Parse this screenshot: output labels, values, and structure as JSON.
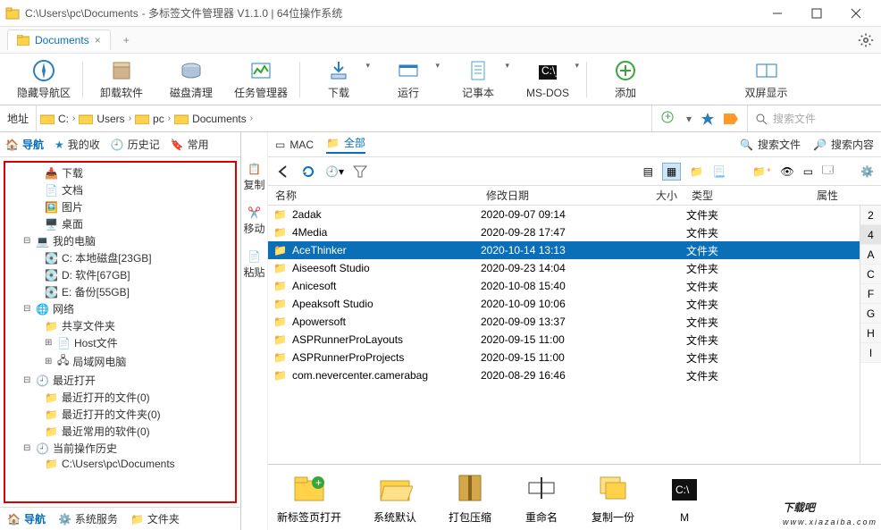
{
  "title": {
    "path": "C:\\Users\\pc\\Documents",
    "app": " - 多标签文件管理器 V1.1.0  |  64位操作系统"
  },
  "tab": {
    "name": "Documents"
  },
  "ribbon": [
    {
      "key": "hide-nav",
      "label": "隐藏导航区"
    },
    {
      "key": "uninstall",
      "label": "卸载软件"
    },
    {
      "key": "disk-clean",
      "label": "磁盘清理"
    },
    {
      "key": "task-manager",
      "label": "任务管理器"
    },
    {
      "key": "download",
      "label": "下载"
    },
    {
      "key": "run",
      "label": "运行"
    },
    {
      "key": "notepad",
      "label": "记事本"
    },
    {
      "key": "msdos",
      "label": "MS-DOS"
    },
    {
      "key": "add",
      "label": "添加"
    },
    {
      "key": "dual-screen",
      "label": "双屏显示"
    }
  ],
  "addr": {
    "label": "地址",
    "c": "C:",
    "users": "Users",
    "pc": "pc",
    "docs": "Documents",
    "search_ph": "搜索文件"
  },
  "left_tabs": {
    "nav": "导航",
    "myfav": "我的收",
    "history": "历史记",
    "common": "常用"
  },
  "tree": {
    "downloads": "下载",
    "docs": "文档",
    "pics": "图片",
    "desktop": "桌面",
    "mypc": "我的电脑",
    "cdrive": "C: 本地磁盘[23GB]",
    "ddrive": "D: 软件[67GB]",
    "edrive": "E: 备份[55GB]",
    "network": "网络",
    "share": "共享文件夹",
    "hosts": "Host文件",
    "lan": "局域网电脑",
    "recent": "最近打开",
    "recent_files": "最近打开的文件(0)",
    "recent_folders": "最近打开的文件夹(0)",
    "recent_apps": "最近常用的软件(0)",
    "ophist": "当前操作历史",
    "ophist_path": "C:\\Users\\pc\\Documents"
  },
  "bottom_tabs": {
    "nav": "导航",
    "services": "系统服务",
    "folder": "文件夹"
  },
  "side_actions": {
    "copy": "复制",
    "move": "移动",
    "paste": "粘贴"
  },
  "right_tabs": {
    "mac": "MAC",
    "all": "全部",
    "search_file": "搜索文件",
    "search_content": "搜索内容"
  },
  "cols": {
    "name": "名称",
    "date": "修改日期",
    "size": "大小",
    "type": "类型",
    "attr": "属性"
  },
  "type_folder": "文件夹",
  "rows": [
    {
      "name": "2adak",
      "date": "2020-09-07 09:14"
    },
    {
      "name": "4Media",
      "date": "2020-09-28 17:47"
    },
    {
      "name": "AceThinker",
      "date": "2020-10-14 13:13",
      "selected": true
    },
    {
      "name": "Aiseesoft Studio",
      "date": "2020-09-23 14:04"
    },
    {
      "name": "Anicesoft",
      "date": "2020-10-08 15:40"
    },
    {
      "name": "Apeaksoft Studio",
      "date": "2020-10-09 10:06"
    },
    {
      "name": "Apowersoft",
      "date": "2020-09-09 13:37"
    },
    {
      "name": "ASPRunnerProLayouts",
      "date": "2020-09-15 11:00"
    },
    {
      "name": "ASPRunnerProProjects",
      "date": "2020-09-15 11:00"
    },
    {
      "name": "com.nevercenter.camerabag",
      "date": "2020-08-29 16:46"
    }
  ],
  "letters": [
    "2",
    "4",
    "A",
    "C",
    "F",
    "G",
    "H",
    "I"
  ],
  "actions": {
    "newtab": "新标签页打开",
    "sysdefault": "系统默认",
    "compress": "打包压缩",
    "rename": "重命名",
    "copy": "复制一份"
  },
  "watermark": {
    "main": "下载吧",
    "sub": "www.xiazaiba.com"
  }
}
